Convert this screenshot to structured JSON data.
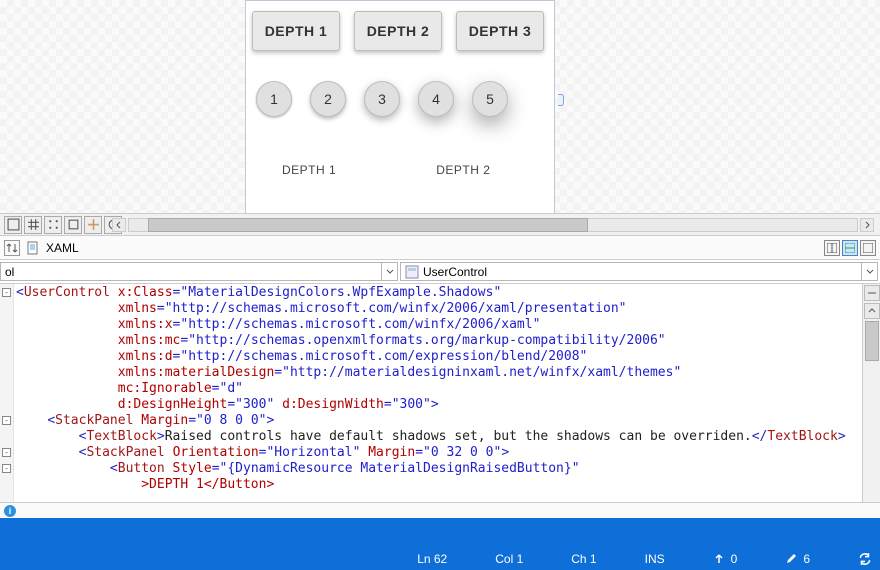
{
  "designer": {
    "depth_buttons": [
      "DEPTH 1",
      "DEPTH 2",
      "DEPTH 3"
    ],
    "circle_buttons": [
      "1",
      "2",
      "3",
      "4",
      "5"
    ],
    "depth_labels": [
      "DEPTH 1",
      "DEPTH 2"
    ]
  },
  "pane": {
    "tab_label": "XAML",
    "breadcrumb_left": "ol",
    "breadcrumb_right": "UserControl"
  },
  "code": {
    "lines": [
      {
        "indent": 0,
        "raw": [
          [
            "dl",
            "<"
          ],
          [
            "el",
            "UserControl"
          ],
          [
            "tx",
            " "
          ],
          [
            "an",
            "x:Class"
          ],
          [
            "dl",
            "="
          ],
          [
            "av",
            "\"MaterialDesignColors.WpfExample.Shadows\""
          ]
        ]
      },
      {
        "indent": 13,
        "raw": [
          [
            "an",
            "xmlns"
          ],
          [
            "dl",
            "="
          ],
          [
            "av",
            "\"http://schemas.microsoft.com/winfx/2006/xaml/presentation\""
          ]
        ]
      },
      {
        "indent": 13,
        "raw": [
          [
            "an",
            "xmlns:x"
          ],
          [
            "dl",
            "="
          ],
          [
            "av",
            "\"http://schemas.microsoft.com/winfx/2006/xaml\""
          ]
        ]
      },
      {
        "indent": 13,
        "raw": [
          [
            "an",
            "xmlns:mc"
          ],
          [
            "dl",
            "="
          ],
          [
            "av",
            "\"http://schemas.openxmlformats.org/markup-compatibility/2006\""
          ]
        ]
      },
      {
        "indent": 13,
        "raw": [
          [
            "an",
            "xmlns:d"
          ],
          [
            "dl",
            "="
          ],
          [
            "av",
            "\"http://schemas.microsoft.com/expression/blend/2008\""
          ]
        ]
      },
      {
        "indent": 13,
        "raw": [
          [
            "an",
            "xmlns:materialDesign"
          ],
          [
            "dl",
            "="
          ],
          [
            "av",
            "\"http://materialdesigninxaml.net/winfx/xaml/themes\""
          ]
        ]
      },
      {
        "indent": 13,
        "raw": [
          [
            "an",
            "mc:Ignorable"
          ],
          [
            "dl",
            "="
          ],
          [
            "av",
            "\"d\""
          ]
        ]
      },
      {
        "indent": 13,
        "raw": [
          [
            "an",
            "d:DesignHeight"
          ],
          [
            "dl",
            "="
          ],
          [
            "av",
            "\"300\""
          ],
          [
            "tx",
            " "
          ],
          [
            "an",
            "d:DesignWidth"
          ],
          [
            "dl",
            "="
          ],
          [
            "av",
            "\"300\""
          ],
          [
            "dl",
            ">"
          ]
        ]
      },
      {
        "indent": 4,
        "raw": [
          [
            "dl",
            "<"
          ],
          [
            "el",
            "StackPanel"
          ],
          [
            "tx",
            " "
          ],
          [
            "an",
            "Margin"
          ],
          [
            "dl",
            "="
          ],
          [
            "av",
            "\"0 8 0 0\""
          ],
          [
            "dl",
            ">"
          ]
        ]
      },
      {
        "indent": 8,
        "raw": [
          [
            "dl",
            "<"
          ],
          [
            "el",
            "TextBlock"
          ],
          [
            "dl",
            ">"
          ],
          [
            "tx",
            "Raised controls have default shadows set, but the shadows can be overriden."
          ],
          [
            "dl",
            "</"
          ],
          [
            "el",
            "TextBlock"
          ],
          [
            "dl",
            ">"
          ]
        ]
      },
      {
        "indent": 8,
        "raw": [
          [
            "dl",
            "<"
          ],
          [
            "el",
            "StackPanel"
          ],
          [
            "tx",
            " "
          ],
          [
            "an",
            "Orientation"
          ],
          [
            "dl",
            "="
          ],
          [
            "av",
            "\"Horizontal\""
          ],
          [
            "tx",
            " "
          ],
          [
            "an",
            "Margin"
          ],
          [
            "dl",
            "="
          ],
          [
            "av",
            "\"0 32 0 0\""
          ],
          [
            "dl",
            ">"
          ]
        ]
      },
      {
        "indent": 12,
        "raw": [
          [
            "dl",
            "<"
          ],
          [
            "el",
            "Button"
          ],
          [
            "tx",
            " "
          ],
          [
            "an",
            "Style"
          ],
          [
            "dl",
            "="
          ],
          [
            "av",
            "\"{DynamicResource MaterialDesignRaisedButton}\""
          ]
        ]
      },
      {
        "indent": 16,
        "raw": [
          [
            "ig",
            ">DEPTH 1</Button>"
          ]
        ]
      }
    ],
    "folds": [
      {
        "line": 0,
        "glyph": "-"
      },
      {
        "line": 8,
        "glyph": "-"
      },
      {
        "line": 10,
        "glyph": "-"
      },
      {
        "line": 11,
        "glyph": "-"
      }
    ]
  },
  "status": {
    "ln": "Ln 62",
    "col": "Col 1",
    "ch": "Ch 1",
    "ins": "INS",
    "up_count": "0",
    "pencil_count": "6"
  }
}
